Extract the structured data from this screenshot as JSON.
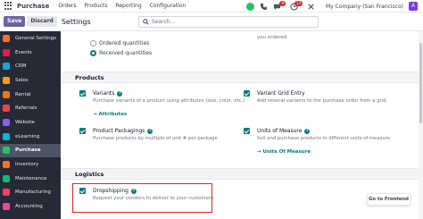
{
  "navbar": {
    "brand": "Purchase",
    "menu": [
      "Orders",
      "Products",
      "Reporting",
      "Configuration"
    ],
    "badge_chat": "9",
    "badge_activity": "13",
    "company": "My Company (San Francisco)",
    "avatar_letter": "A"
  },
  "control_panel": {
    "save_label": "Save",
    "discard_label": "Discard",
    "title": "Settings",
    "search_placeholder": "Search..."
  },
  "sidebar": {
    "items": [
      {
        "label": "General Settings",
        "color": "#f97316"
      },
      {
        "label": "Events",
        "color": "#e11d48"
      },
      {
        "label": "CRM",
        "color": "#0ea5e9"
      },
      {
        "label": "Sales",
        "color": "#f59e0b"
      },
      {
        "label": "Rental",
        "color": "#f97316"
      },
      {
        "label": "Referrals",
        "color": "#ef4444"
      },
      {
        "label": "Website",
        "color": "#8b5cf6"
      },
      {
        "label": "eLearning",
        "color": "#06b6d4"
      },
      {
        "label": "Purchase",
        "color": "#22c55e"
      },
      {
        "label": "Inventory",
        "color": "#f97316"
      },
      {
        "label": "Maintenance",
        "color": "#10b981"
      },
      {
        "label": "Manufacturing",
        "color": "#f43f5e"
      },
      {
        "label": "Accounting",
        "color": "#ec4899"
      }
    ],
    "active_index": 8
  },
  "main": {
    "radio_ordered": "Ordered quantities",
    "radio_received": "Received quantities",
    "top_right_text": "you ordered",
    "products_header": "Products",
    "variants_title": "Variants",
    "variants_desc": "Purchase variants of a product using attributes (size, color, etc.)",
    "variants_link": "Attributes",
    "grid_title": "Variant Grid Entry",
    "grid_desc": "Add several variants to the purchase order from a grid",
    "pack_title": "Product Packagings",
    "pack_desc": "Purchase products by multiple of unit # per package",
    "uom_title": "Units of Measure",
    "uom_desc": "Sell and purchase products in different units of measure",
    "uom_link": "Units Of Measure",
    "logistics_header": "Logistics",
    "drop_title": "Dropshipping",
    "drop_desc": "Request your vendors to deliver to your customers",
    "help_glyph": "?",
    "frontend_button": "Go to Frontend"
  }
}
